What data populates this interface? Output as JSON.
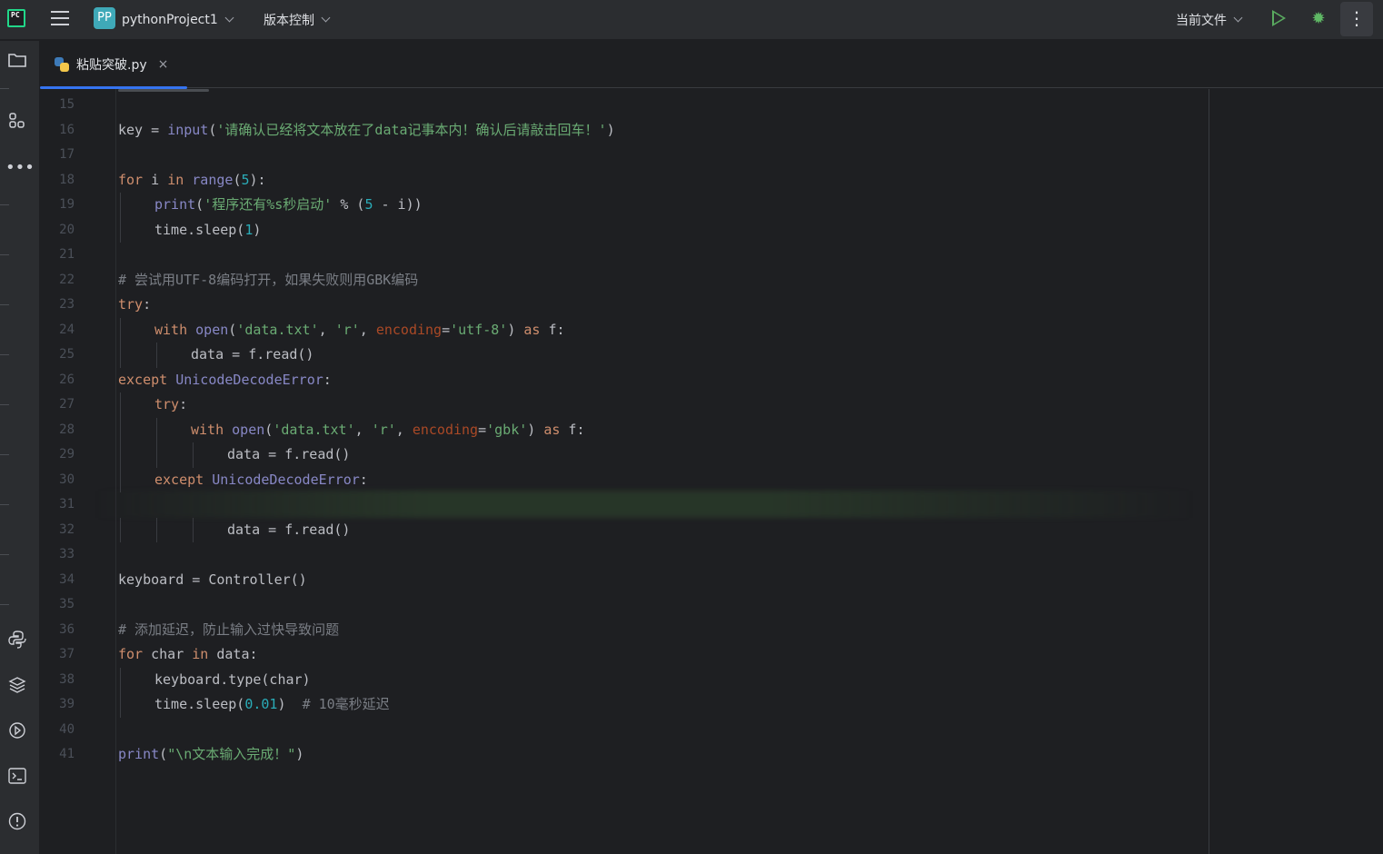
{
  "titlebar": {
    "project_badge": "PP",
    "project_name": "pythonProject1",
    "vcs_label": "版本控制",
    "run_config": "当前文件",
    "more_label": "⋮"
  },
  "tab": {
    "filename": "粘贴突破.py",
    "close": "×"
  },
  "colors": {
    "accent": "#3574f0",
    "keyword": "#cf8e6d",
    "string": "#6aab73",
    "number": "#2aacb8",
    "comment": "#7a7e85",
    "run": "#5fb865"
  },
  "editor": {
    "lines": [
      {
        "n": "15",
        "indent": 0,
        "tokens": []
      },
      {
        "n": "16",
        "indent": 0,
        "tokens": [
          {
            "t": "key = ",
            "c": ""
          },
          {
            "t": "input",
            "c": "b"
          },
          {
            "t": "(",
            "c": ""
          },
          {
            "t": "'请确认已经将文本放在了data记事本内！确认后请敲击回车！'",
            "c": "s"
          },
          {
            "t": ")",
            "c": ""
          }
        ]
      },
      {
        "n": "17",
        "indent": 0,
        "tokens": []
      },
      {
        "n": "18",
        "indent": 0,
        "tokens": [
          {
            "t": "for",
            "c": "k"
          },
          {
            "t": " i ",
            "c": ""
          },
          {
            "t": "in",
            "c": "k"
          },
          {
            "t": " ",
            "c": ""
          },
          {
            "t": "range",
            "c": "b"
          },
          {
            "t": "(",
            "c": ""
          },
          {
            "t": "5",
            "c": "n"
          },
          {
            "t": "):",
            "c": ""
          }
        ]
      },
      {
        "n": "19",
        "indent": 1,
        "tokens": [
          {
            "t": "print",
            "c": "b"
          },
          {
            "t": "(",
            "c": ""
          },
          {
            "t": "'程序还有%s秒启动'",
            "c": "s"
          },
          {
            "t": " % (",
            "c": ""
          },
          {
            "t": "5",
            "c": "n"
          },
          {
            "t": " - i))",
            "c": ""
          }
        ]
      },
      {
        "n": "20",
        "indent": 1,
        "tokens": [
          {
            "t": "time.sleep(",
            "c": ""
          },
          {
            "t": "1",
            "c": "n"
          },
          {
            "t": ")",
            "c": ""
          }
        ]
      },
      {
        "n": "21",
        "indent": 0,
        "tokens": []
      },
      {
        "n": "22",
        "indent": 0,
        "tokens": [
          {
            "t": "# 尝试用UTF-8编码打开，如果失败则用GBK编码",
            "c": "c"
          }
        ]
      },
      {
        "n": "23",
        "indent": 0,
        "tokens": [
          {
            "t": "try",
            "c": "k"
          },
          {
            "t": ":",
            "c": ""
          }
        ]
      },
      {
        "n": "24",
        "indent": 1,
        "tokens": [
          {
            "t": "with",
            "c": "k"
          },
          {
            "t": " ",
            "c": ""
          },
          {
            "t": "open",
            "c": "b"
          },
          {
            "t": "(",
            "c": ""
          },
          {
            "t": "'data.txt'",
            "c": "s"
          },
          {
            "t": ", ",
            "c": ""
          },
          {
            "t": "'r'",
            "c": "s"
          },
          {
            "t": ", ",
            "c": ""
          },
          {
            "t": "encoding",
            "c": "p"
          },
          {
            "t": "=",
            "c": ""
          },
          {
            "t": "'utf-8'",
            "c": "s"
          },
          {
            "t": ") ",
            "c": ""
          },
          {
            "t": "as",
            "c": "k"
          },
          {
            "t": " f:",
            "c": ""
          }
        ]
      },
      {
        "n": "25",
        "indent": 2,
        "tokens": [
          {
            "t": "data = f.read()",
            "c": ""
          }
        ]
      },
      {
        "n": "26",
        "indent": 0,
        "tokens": [
          {
            "t": "except",
            "c": "k"
          },
          {
            "t": " ",
            "c": ""
          },
          {
            "t": "UnicodeDecodeError",
            "c": "b"
          },
          {
            "t": ":",
            "c": ""
          }
        ]
      },
      {
        "n": "27",
        "indent": 1,
        "tokens": [
          {
            "t": "try",
            "c": "k"
          },
          {
            "t": ":",
            "c": ""
          }
        ]
      },
      {
        "n": "28",
        "indent": 2,
        "tokens": [
          {
            "t": "with",
            "c": "k"
          },
          {
            "t": " ",
            "c": ""
          },
          {
            "t": "open",
            "c": "b"
          },
          {
            "t": "(",
            "c": ""
          },
          {
            "t": "'data.txt'",
            "c": "s"
          },
          {
            "t": ", ",
            "c": ""
          },
          {
            "t": "'r'",
            "c": "s"
          },
          {
            "t": ", ",
            "c": ""
          },
          {
            "t": "encoding",
            "c": "p"
          },
          {
            "t": "=",
            "c": ""
          },
          {
            "t": "'gbk'",
            "c": "s"
          },
          {
            "t": ") ",
            "c": ""
          },
          {
            "t": "as",
            "c": "k"
          },
          {
            "t": " f:",
            "c": ""
          }
        ]
      },
      {
        "n": "29",
        "indent": 3,
        "tokens": [
          {
            "t": "data = f.read()",
            "c": ""
          }
        ]
      },
      {
        "n": "30",
        "indent": 1,
        "tokens": [
          {
            "t": "except",
            "c": "k"
          },
          {
            "t": " ",
            "c": ""
          },
          {
            "t": "UnicodeDecodeError",
            "c": "b"
          },
          {
            "t": ":",
            "c": ""
          }
        ]
      },
      {
        "n": "31",
        "indent": 0,
        "tokens": []
      },
      {
        "n": "32",
        "indent": 3,
        "tokens": [
          {
            "t": "data = f.read()",
            "c": ""
          }
        ]
      },
      {
        "n": "33",
        "indent": 0,
        "tokens": []
      },
      {
        "n": "34",
        "indent": 0,
        "tokens": [
          {
            "t": "keyboard = Controller()",
            "c": ""
          }
        ]
      },
      {
        "n": "35",
        "indent": 0,
        "tokens": []
      },
      {
        "n": "36",
        "indent": 0,
        "tokens": [
          {
            "t": "# 添加延迟，防止输入过快导致问题",
            "c": "c"
          }
        ]
      },
      {
        "n": "37",
        "indent": 0,
        "tokens": [
          {
            "t": "for",
            "c": "k"
          },
          {
            "t": " char ",
            "c": ""
          },
          {
            "t": "in",
            "c": "k"
          },
          {
            "t": " data:",
            "c": ""
          }
        ]
      },
      {
        "n": "38",
        "indent": 1,
        "tokens": [
          {
            "t": "keyboard.type(char)",
            "c": ""
          }
        ]
      },
      {
        "n": "39",
        "indent": 1,
        "tokens": [
          {
            "t": "time.sleep(",
            "c": ""
          },
          {
            "t": "0.01",
            "c": "n"
          },
          {
            "t": ")  ",
            "c": ""
          },
          {
            "t": "# 10毫秒延迟",
            "c": "c"
          }
        ]
      },
      {
        "n": "40",
        "indent": 0,
        "tokens": []
      },
      {
        "n": "41",
        "indent": 0,
        "tokens": [
          {
            "t": "print",
            "c": "b"
          },
          {
            "t": "(",
            "c": ""
          },
          {
            "t": "\"\\n文本输入完成！\"",
            "c": "s"
          },
          {
            "t": ")",
            "c": ""
          }
        ]
      }
    ]
  },
  "leftbar": {
    "top_icons": [
      "folder-icon",
      "structure-icon",
      "more-tools-icon"
    ],
    "bottom_icons": [
      "python-console-icon",
      "layers-icon",
      "services-icon",
      "terminal-icon",
      "problems-icon"
    ]
  }
}
